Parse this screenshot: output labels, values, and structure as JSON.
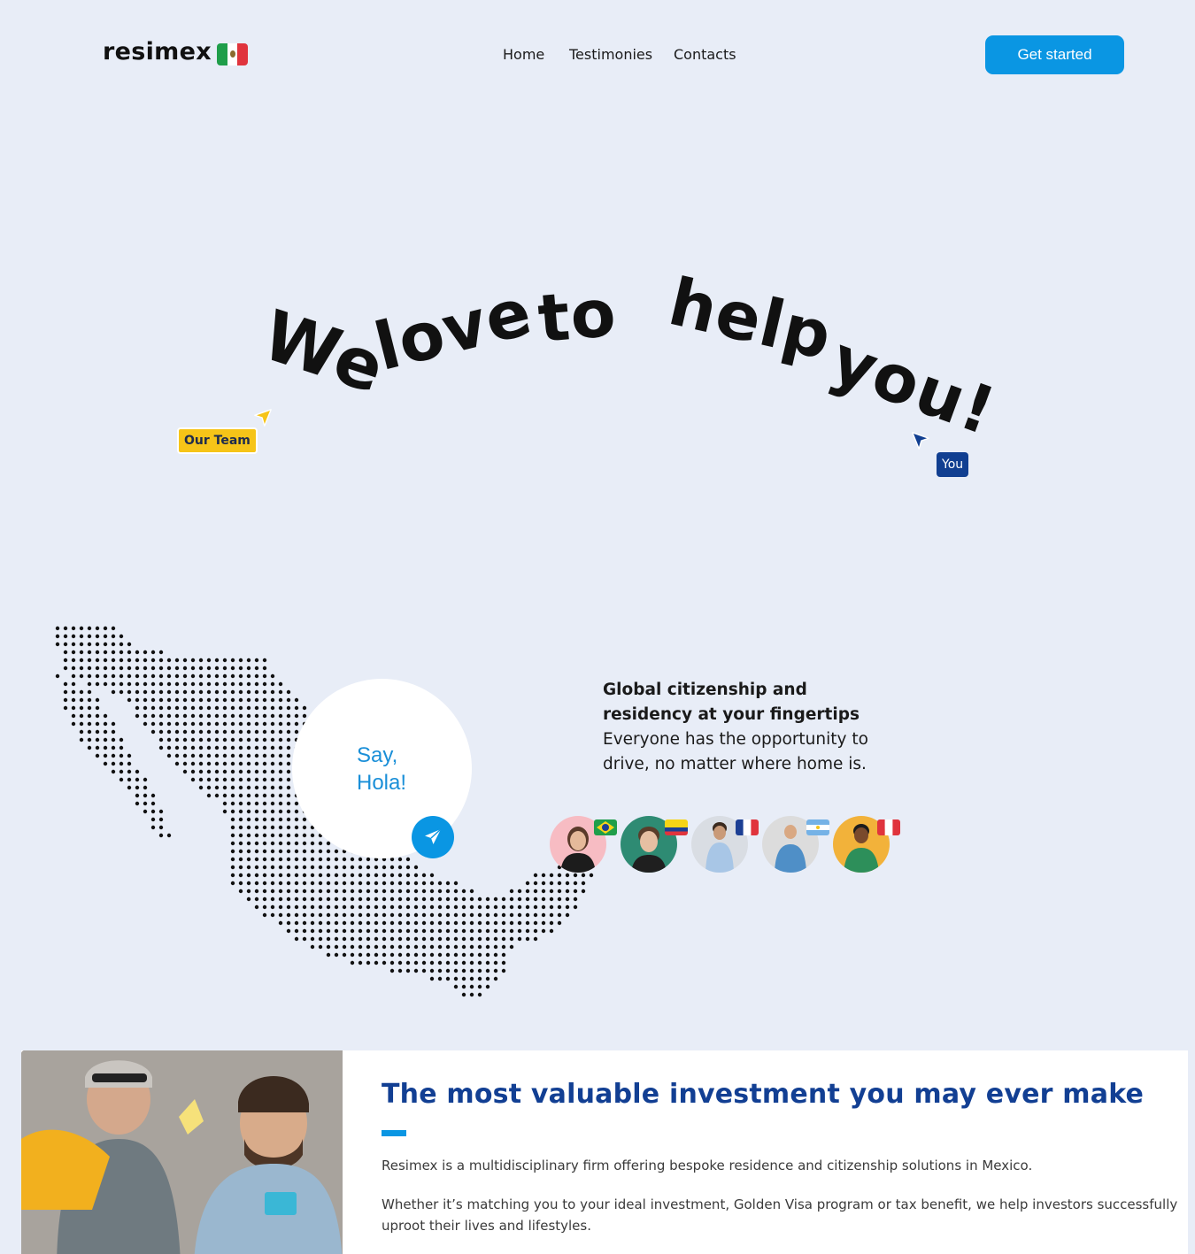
{
  "header": {
    "logo": "resimex",
    "nav": [
      "Home",
      "Testimonies",
      "Contacts"
    ],
    "cta": "Get started"
  },
  "hero": {
    "words": [
      "We",
      "love",
      "to",
      "help",
      "you!"
    ],
    "tag_team": "Our Team",
    "tag_you": "You"
  },
  "map_section": {
    "greeting_line1": "Say,",
    "greeting_line2": "Hola!",
    "tagline_bold": "Global citizenship and residency at your fingertips",
    "tagline_text": "Everyone has the opportunity to drive, no matter where home is.",
    "avatars": [
      {
        "flag": "Brazil",
        "bg": "#f7bcc3"
      },
      {
        "flag": "Colombia",
        "bg": "#2e8b73"
      },
      {
        "flag": "France",
        "bg": "#d9dde3"
      },
      {
        "flag": "Argentina",
        "bg": "#dcdcdc"
      },
      {
        "flag": "Peru",
        "bg": "#f2b23a"
      }
    ]
  },
  "investment": {
    "title": "The most valuable investment you may ever make",
    "p1": "Resimex is a multidisciplinary firm offering bespoke residence and citizenship solutions in Mexico.",
    "p2": "Whether it’s matching you to your ideal investment, Golden Visa program or tax benefit, we help investors successfully uproot their lives and lifestyles."
  },
  "colors": {
    "background": "#e8edf7",
    "accent": "#0a96e3",
    "title_blue": "#123f93",
    "team_yellow": "#f6c418",
    "you_blue": "#113f91"
  }
}
